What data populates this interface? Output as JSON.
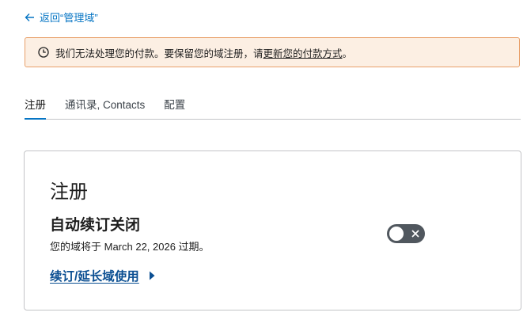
{
  "nav": {
    "back_label": "返回“管理域”"
  },
  "banner": {
    "message": "我们无法处理您的付款。要保留您的域注册，请",
    "link_label": "更新您的付款方式",
    "suffix": "。"
  },
  "tabs": [
    {
      "label": "注册",
      "active": true
    },
    {
      "label": "通讯录, Contacts",
      "active": false
    },
    {
      "label": "配置",
      "active": false
    }
  ],
  "card": {
    "title": "注册",
    "auto_renew_heading": "自动续订关闭",
    "expiry_text": "您的域将于 March 22, 2026 过期。",
    "renew_link_label": "续订/延长域使用",
    "auto_renew_enabled": false
  },
  "colors": {
    "accent": "#0675c4",
    "link_dark": "#0b4f92",
    "warning_bg": "#fcefe3",
    "warning_border": "#e8a06a",
    "toggle_off": "#50575e"
  },
  "icons": {
    "back": "arrow-left-icon",
    "banner": "clock-icon",
    "renew": "caret-right-icon",
    "toggle": "close-icon"
  }
}
